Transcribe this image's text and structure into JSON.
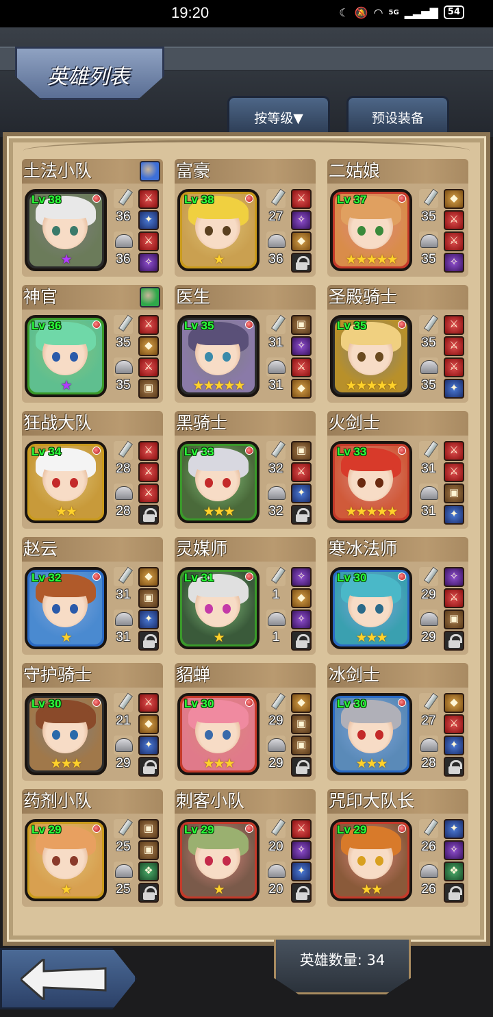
{
  "status_bar": {
    "time": "19:20",
    "network": "5G",
    "battery": "54"
  },
  "title": "英雄列表",
  "tabs": {
    "sort_label": "按等级▼",
    "preset_label": "预设装备"
  },
  "hero_count_label": "英雄数量: 34",
  "heroes": [
    {
      "name": "土法小队",
      "level": "Lv 38",
      "atk": "36",
      "def": "36",
      "stars": "★",
      "star_color": "purple",
      "frame": "#2a2a2a",
      "bg": "#6b7b5a",
      "hair": "#e8e8e8",
      "eye": "#3a7a6a",
      "gem": "#3d6fd8",
      "equip": [
        "red",
        "blue",
        "red",
        "purple"
      ]
    },
    {
      "name": "富豪",
      "level": "Lv 38",
      "atk": "27",
      "def": "36",
      "stars": "★",
      "star_color": "gold",
      "frame": "#c99a1c",
      "bg": "#caa050",
      "hair": "#f0d040",
      "eye": "#5a4020",
      "gem": null,
      "equip": [
        "red",
        "purple",
        "gold",
        "lock"
      ]
    },
    {
      "name": "二姑娘",
      "level": "Lv 37",
      "atk": "35",
      "def": "35",
      "stars": "★★★★★",
      "star_color": "gold",
      "frame": "#c43a2a",
      "bg": "#d98c4a",
      "hair": "#e0a060",
      "eye": "#3a8a3a",
      "gem": null,
      "equip": [
        "gold",
        "red",
        "red",
        "purple"
      ]
    },
    {
      "name": "神官",
      "level": "Lv 36",
      "atk": "35",
      "def": "35",
      "stars": "★",
      "star_color": "purple",
      "frame": "#3a9a2a",
      "bg": "#5fbf8f",
      "hair": "#6fd8a8",
      "eye": "#2a5aaa",
      "gem": "#2ea84a",
      "equip": [
        "red",
        "gold",
        "red",
        "brown"
      ]
    },
    {
      "name": "医生",
      "level": "Lv 35",
      "atk": "31",
      "def": "31",
      "stars": "★★★★★",
      "star_color": "gold",
      "frame": "#2a2a2a",
      "bg": "#8a7aa8",
      "hair": "#5a5078",
      "eye": "#3a8aaa",
      "gem": null,
      "equip": [
        "brown",
        "purple",
        "red",
        "gold"
      ]
    },
    {
      "name": "圣殿骑士",
      "level": "Lv 35",
      "atk": "35",
      "def": "35",
      "stars": "★★★★★",
      "star_color": "gold",
      "frame": "#2a2a2a",
      "bg": "#b8902a",
      "hair": "#f0d080",
      "eye": "#6a4a20",
      "gem": null,
      "equip": [
        "red",
        "red",
        "red",
        "blue"
      ]
    },
    {
      "name": "狂战大队",
      "level": "Lv 34",
      "atk": "28",
      "def": "28",
      "stars": "★★",
      "star_color": "gold",
      "frame": "#c99a1c",
      "bg": "#c89a3a",
      "hair": "#f4f4f4",
      "eye": "#c42a2a",
      "gem": null,
      "equip": [
        "red",
        "red",
        "red",
        "lock"
      ]
    },
    {
      "name": "黑骑士",
      "level": "Lv 33",
      "atk": "32",
      "def": "32",
      "stars": "★★★",
      "star_color": "gold",
      "frame": "#3a9a2a",
      "bg": "#4a6a3a",
      "hair": "#d8d8e0",
      "eye": "#c42a2a",
      "gem": null,
      "equip": [
        "brown",
        "red",
        "blue",
        "lock"
      ]
    },
    {
      "name": "火剑士",
      "level": "Lv 33",
      "atk": "31",
      "def": "31",
      "stars": "★★★★★",
      "star_color": "gold",
      "frame": "#c43a2a",
      "bg": "#d05a3a",
      "hair": "#d83a2a",
      "eye": "#6a2a10",
      "gem": null,
      "equip": [
        "red",
        "red",
        "brown",
        "blue"
      ]
    },
    {
      "name": "赵云",
      "level": "Lv 32",
      "atk": "31",
      "def": "31",
      "stars": "★",
      "star_color": "gold",
      "frame": "#2a6ac4",
      "bg": "#4a8ad0",
      "hair": "#b05a2a",
      "eye": "#2a5aaa",
      "gem": null,
      "equip": [
        "gold",
        "brown",
        "blue",
        "lock"
      ]
    },
    {
      "name": "灵媒师",
      "level": "Lv 31",
      "atk": "1",
      "def": "1",
      "stars": "★",
      "star_color": "gold",
      "frame": "#3a9a2a",
      "bg": "#3a5a3a",
      "hair": "#e0e0e0",
      "eye": "#c43aa8",
      "gem": null,
      "equip": [
        "purple",
        "gold",
        "purple",
        "lock"
      ]
    },
    {
      "name": "寒冰法师",
      "level": "Lv 30",
      "atk": "29",
      "def": "29",
      "stars": "★★★",
      "star_color": "gold",
      "frame": "#2a6ac4",
      "bg": "#3aa0b0",
      "hair": "#4ab8c8",
      "eye": "#2a6a8a",
      "gem": null,
      "equip": [
        "purple",
        "red",
        "brown",
        "lock"
      ]
    },
    {
      "name": "守护骑士",
      "level": "Lv 30",
      "atk": "21",
      "def": "29",
      "stars": "★★★",
      "star_color": "gold",
      "frame": "#2a2a2a",
      "bg": "#a0784a",
      "hair": "#8a4a2a",
      "eye": "#2a6aaa",
      "gem": null,
      "equip": [
        "red",
        "gold",
        "blue",
        "lock"
      ]
    },
    {
      "name": "貂蝉",
      "level": "Lv 30",
      "atk": "29",
      "def": "29",
      "stars": "★★★",
      "star_color": "gold",
      "frame": "#c43a2a",
      "bg": "#e07a8a",
      "hair": "#f08aa0",
      "eye": "#3a6aaa",
      "gem": null,
      "equip": [
        "gold",
        "brown",
        "brown",
        "lock"
      ]
    },
    {
      "name": "冰剑士",
      "level": "Lv 30",
      "atk": "27",
      "def": "28",
      "stars": "★★★",
      "star_color": "gold",
      "frame": "#2a6ac4",
      "bg": "#5a8ab8",
      "hair": "#b0b0b8",
      "eye": "#c42a2a",
      "gem": null,
      "equip": [
        "gold",
        "red",
        "blue",
        "lock"
      ]
    },
    {
      "name": "药剂小队",
      "level": "Lv 29",
      "atk": "25",
      "def": "25",
      "stars": "★",
      "star_color": "gold",
      "frame": "#c99a1c",
      "bg": "#d8a050",
      "hair": "#e8a060",
      "eye": "#8a3a2a",
      "gem": null,
      "equip": [
        "brown",
        "brown",
        "green",
        "lock"
      ]
    },
    {
      "name": "刺客小队",
      "level": "Lv 29",
      "atk": "20",
      "def": "20",
      "stars": "★",
      "star_color": "gold",
      "frame": "#c43a2a",
      "bg": "#7a5a4a",
      "hair": "#9ab070",
      "eye": "#c42a4a",
      "gem": null,
      "equip": [
        "red",
        "purple",
        "blue",
        "lock"
      ]
    },
    {
      "name": "咒印大队长",
      "level": "Lv 29",
      "atk": "26",
      "def": "26",
      "stars": "★★",
      "star_color": "gold",
      "frame": "#c43a2a",
      "bg": "#8a5a3a",
      "hair": "#d87a2a",
      "eye": "#d8a020",
      "gem": null,
      "equip": [
        "blue",
        "purple",
        "green",
        "lock"
      ]
    }
  ]
}
